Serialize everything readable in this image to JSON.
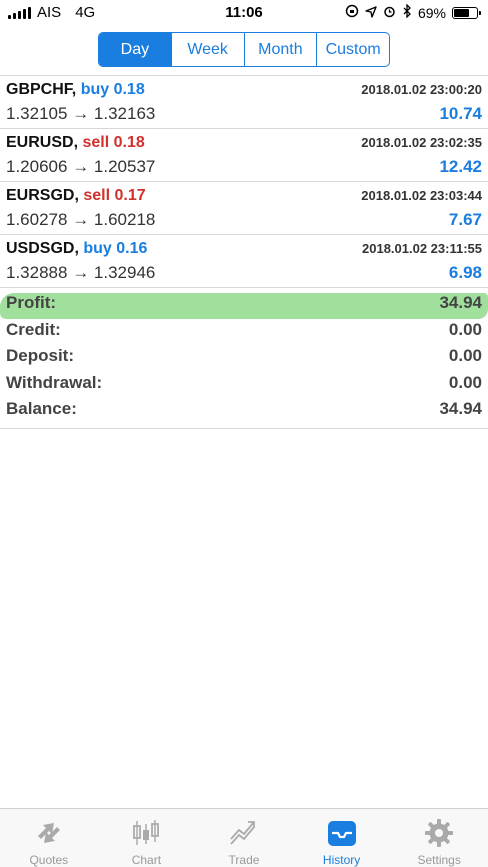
{
  "status_bar": {
    "carrier": "AIS",
    "network": "4G",
    "time": "11:06",
    "battery_percent": "69%",
    "battery_level": 0.69
  },
  "period_tabs": [
    {
      "label": "Day",
      "active": true
    },
    {
      "label": "Week",
      "active": false
    },
    {
      "label": "Month",
      "active": false
    },
    {
      "label": "Custom",
      "active": false
    }
  ],
  "trades": [
    {
      "symbol": "GBPCHF,",
      "side": "buy",
      "volume": "0.18",
      "side_label": "buy 0.18",
      "time": "2018.01.02 23:00:20",
      "open_price": "1.32105",
      "arrow": "→",
      "close_price": "1.32163",
      "profit": "10.74"
    },
    {
      "symbol": "EURUSD,",
      "side": "sell",
      "volume": "0.18",
      "side_label": "sell 0.18",
      "time": "2018.01.02 23:02:35",
      "open_price": "1.20606",
      "arrow": "→",
      "close_price": "1.20537",
      "profit": "12.42"
    },
    {
      "symbol": "EURSGD,",
      "side": "sell",
      "volume": "0.17",
      "side_label": "sell 0.17",
      "time": "2018.01.02 23:03:44",
      "open_price": "1.60278",
      "arrow": "→",
      "close_price": "1.60218",
      "profit": "7.67"
    },
    {
      "symbol": "USDSGD,",
      "side": "buy",
      "volume": "0.16",
      "side_label": "buy 0.16",
      "time": "2018.01.02 23:11:55",
      "open_price": "1.32888",
      "arrow": "→",
      "close_price": "1.32946",
      "profit": "6.98"
    }
  ],
  "summary": [
    {
      "label": "Profit:",
      "value": "34.94"
    },
    {
      "label": "Credit:",
      "value": "0.00"
    },
    {
      "label": "Deposit:",
      "value": "0.00"
    },
    {
      "label": "Withdrawal:",
      "value": "0.00"
    },
    {
      "label": "Balance:",
      "value": "34.94"
    }
  ],
  "tab_bar": [
    {
      "label": "Quotes",
      "icon": "quotes-icon",
      "active": false
    },
    {
      "label": "Chart",
      "icon": "candlestick-chart-icon",
      "active": false
    },
    {
      "label": "Trade",
      "icon": "trade-icon",
      "active": false
    },
    {
      "label": "History",
      "icon": "history-inbox-icon",
      "active": true
    },
    {
      "label": "Settings",
      "icon": "gear-icon",
      "active": false
    }
  ],
  "colors": {
    "accent": "#1a7de0",
    "buy": "#1a7de0",
    "sell": "#d0312d",
    "highlight": "#8fdb8b",
    "inactive_tab": "#999999"
  }
}
